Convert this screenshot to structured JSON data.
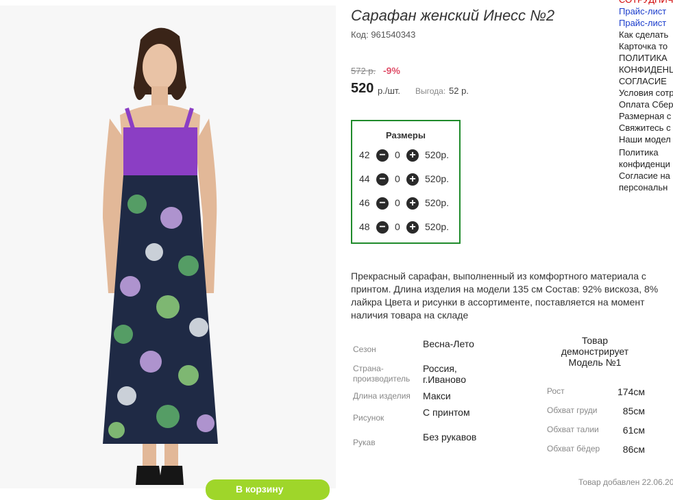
{
  "product": {
    "title": "Сарафан женский Инесс №2",
    "code": "Код: 961540343",
    "old_price": "572 р.",
    "discount": "-9%",
    "price": "520",
    "price_unit": "р./шт.",
    "profit_label": "Выгода:",
    "profit_value": "52 р.",
    "cart_button": "В корзину"
  },
  "sizes": {
    "title": "Размеры",
    "rows": [
      {
        "size": "42",
        "qty": "0",
        "price": "520р."
      },
      {
        "size": "44",
        "qty": "0",
        "price": "520р."
      },
      {
        "size": "46",
        "qty": "0",
        "price": "520р."
      },
      {
        "size": "48",
        "qty": "0",
        "price": "520р."
      }
    ],
    "minus_glyph": "−",
    "plus_glyph": "+"
  },
  "description": "Прекрасный сарафан, выполненный из комфортного материала с принтом. Длина изделия на модели 135 см Состав: 92% вискоза, 8% лайкра Цвета и рисунки в ассортименте, поставляется на момент наличия товара на складе",
  "specs": [
    {
      "label": "Сезон",
      "value": "Весна-Лето"
    },
    {
      "label": "Страна-производитель",
      "value": "Россия, г.Иваново"
    },
    {
      "label": "Длина изделия",
      "value": "Макси"
    },
    {
      "label": "Рисунок",
      "value": "С принтом"
    },
    {
      "label": "Рукав",
      "value": "Без рукавов"
    }
  ],
  "model": {
    "title": "Товар демонстрирует Модель №1",
    "params": [
      {
        "label": "Рост",
        "value": "174см"
      },
      {
        "label": "Обхват груди",
        "value": "85см"
      },
      {
        "label": "Обхват талии",
        "value": "61см"
      },
      {
        "label": "Обхват бёдер",
        "value": "86см"
      }
    ]
  },
  "added": "Товар добавлен 22.06.20",
  "sidebar": [
    {
      "text": "СОТРУДНИЧ",
      "color": "#d00000"
    },
    {
      "text": "Прайс-лист",
      "color": "#1a3ccc"
    },
    {
      "text": "Прайс-лист",
      "color": "#1a3ccc"
    },
    {
      "text": "Как сделать",
      "color": "#222222"
    },
    {
      "text": "Карточка то",
      "color": "#222222"
    },
    {
      "text": "ПОЛИТИКА",
      "color": "#222222"
    },
    {
      "text": "КОНФИДЕНЦ",
      "color": "#222222"
    },
    {
      "text": "СОГЛАСИЕ",
      "color": "#222222"
    },
    {
      "text": "Условия сотр",
      "color": "#222222"
    },
    {
      "text": "Оплата Сбер",
      "color": "#222222"
    },
    {
      "text": "Размерная с",
      "color": "#222222"
    },
    {
      "text": "Свяжитесь с",
      "color": "#222222"
    },
    {
      "text": "Наши модел",
      "color": "#222222"
    },
    {
      "text": "Политика",
      "color": "#222222"
    },
    {
      "text": "конфиденци",
      "color": "#222222"
    },
    {
      "text": "Согласие на",
      "color": "#222222"
    },
    {
      "text": "персональн",
      "color": "#222222"
    }
  ],
  "colors": {
    "accent_green": "#1e8a2a",
    "discount_red": "#e0506a",
    "cart_green": "#9fd62a",
    "dress_purple": "#8b3ec4"
  }
}
